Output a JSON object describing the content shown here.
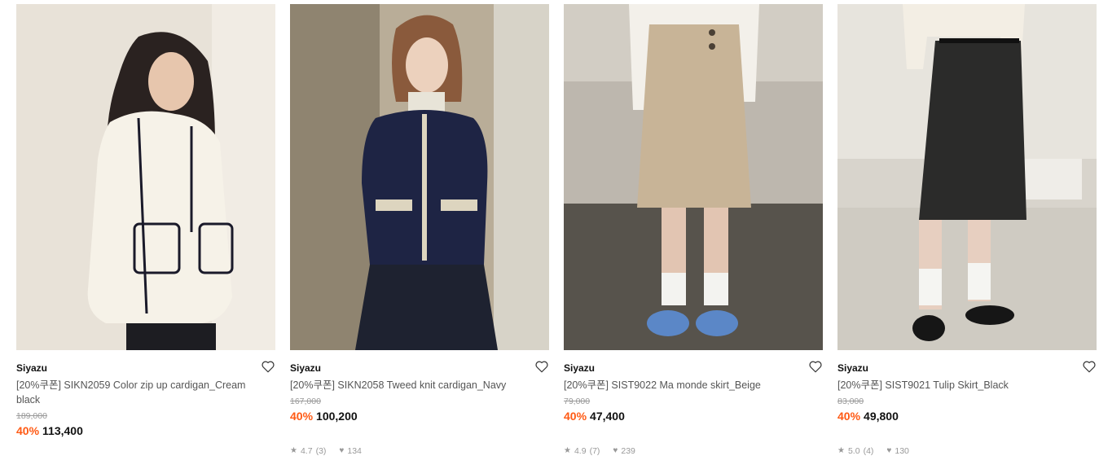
{
  "products": [
    {
      "brand": "Siyazu",
      "title": "[20%쿠폰] SIKN2059 Color zip up cardigan_Cream black",
      "original_price": "189,000",
      "discount": "40%",
      "price": "113,400",
      "rating": "",
      "reviews": "",
      "likes": "",
      "image_desc": "woman-cream-cardigan"
    },
    {
      "brand": "Siyazu",
      "title": "[20%쿠폰] SIKN2058 Tweed knit cardigan_Navy",
      "original_price": "167,000",
      "discount": "40%",
      "price": "100,200",
      "rating": "4.7",
      "reviews": "(3)",
      "likes": "134",
      "image_desc": "woman-navy-cardigan"
    },
    {
      "brand": "Siyazu",
      "title": "[20%쿠폰] SIST9022 Ma monde skirt_Beige",
      "original_price": "79,000",
      "discount": "40%",
      "price": "47,400",
      "rating": "4.9",
      "reviews": "(7)",
      "likes": "239",
      "image_desc": "beige-skirt"
    },
    {
      "brand": "Siyazu",
      "title": "[20%쿠폰] SIST9021 Tulip Skirt_Black",
      "original_price": "83,000",
      "discount": "40%",
      "price": "49,800",
      "rating": "5.0",
      "reviews": "(4)",
      "likes": "130",
      "image_desc": "black-skirt"
    }
  ],
  "colors": {
    "discount": "#ff5a14",
    "muted": "#999999"
  }
}
